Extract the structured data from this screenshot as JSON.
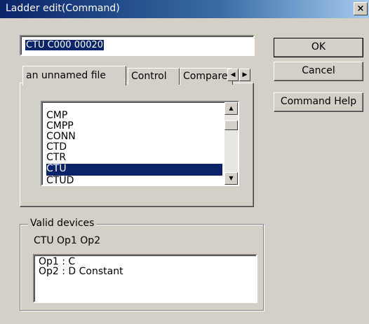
{
  "window": {
    "title": "Ladder edit(Command)",
    "close_glyph": "×"
  },
  "command_input": {
    "value": "CTU C000 00020"
  },
  "buttons": {
    "ok": "OK",
    "cancel": "Cancel",
    "help": "Command Help"
  },
  "tabs": [
    {
      "label": "an unnamed file",
      "active": true
    },
    {
      "label": "Control",
      "active": false
    },
    {
      "label": "Compare",
      "active": false
    }
  ],
  "tab_scroll": {
    "left": "◀",
    "right": "▶"
  },
  "instruction_list": {
    "items": [
      "CMP",
      "CMPP",
      "CONN",
      "CTD",
      "CTR",
      "CTU",
      "CTUD"
    ],
    "selected": "CTU"
  },
  "scrollbar": {
    "up": "▲",
    "down": "▼"
  },
  "valid_devices": {
    "title": "Valid devices",
    "syntax": "CTU Op1 Op2",
    "lines": [
      "Op1 : C",
      "Op2 : D Constant"
    ]
  },
  "colors": {
    "title_bar": "#0a246a",
    "selection": "#0a246a",
    "face": "#d4d0c8"
  }
}
